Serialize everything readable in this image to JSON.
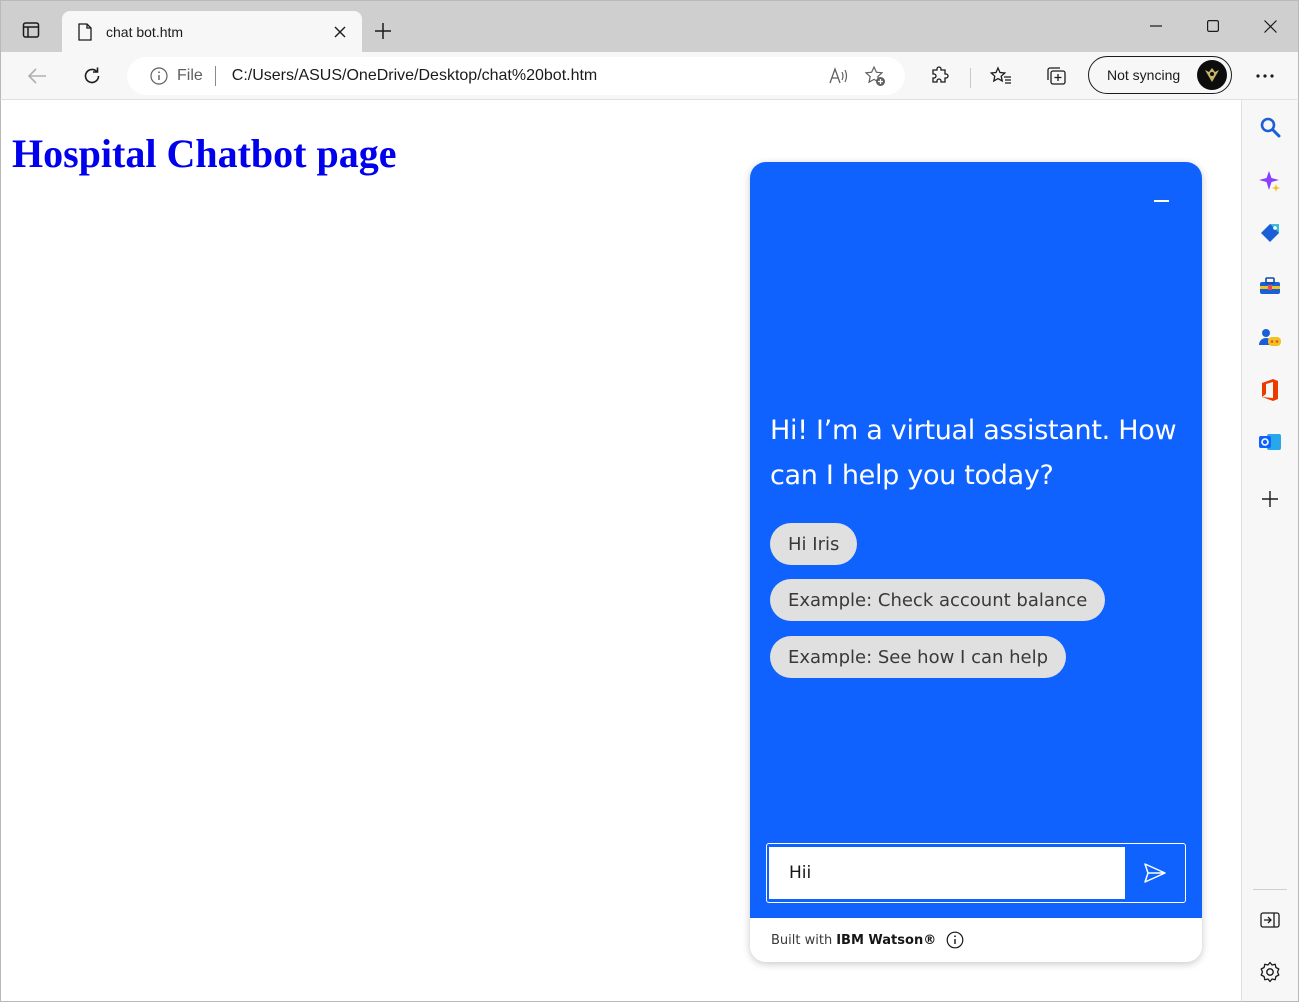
{
  "browser": {
    "tab": {
      "title": "chat bot.htm"
    },
    "address": {
      "scheme_label": "File",
      "url": "C:/Users/ASUS/OneDrive/Desktop/chat%20bot.htm"
    },
    "profile": {
      "sync_label": "Not syncing"
    },
    "sidebar": {
      "icons": [
        "search-icon",
        "copilot-icon",
        "shopping-tag-icon",
        "tools-icon",
        "games-icon",
        "office-icon",
        "outlook-icon",
        "add-icon",
        "split-screen-icon",
        "settings-icon"
      ]
    },
    "colors": {
      "frame": "#cfcfcf",
      "toolbar": "#f7f7f7"
    }
  },
  "page": {
    "heading": "Hospital Chatbot page",
    "heading_color": "#0000ee"
  },
  "chat": {
    "accent_color": "#0f62fe",
    "greeting": "Hi! I’m a virtual assistant. How can I help you today?",
    "options": [
      "Hi Iris",
      "Example: Check account balance",
      "Example: See how I can help"
    ],
    "input_value": "Hii",
    "footer": {
      "prefix": "Built with",
      "brand": "IBM Watson®"
    }
  }
}
